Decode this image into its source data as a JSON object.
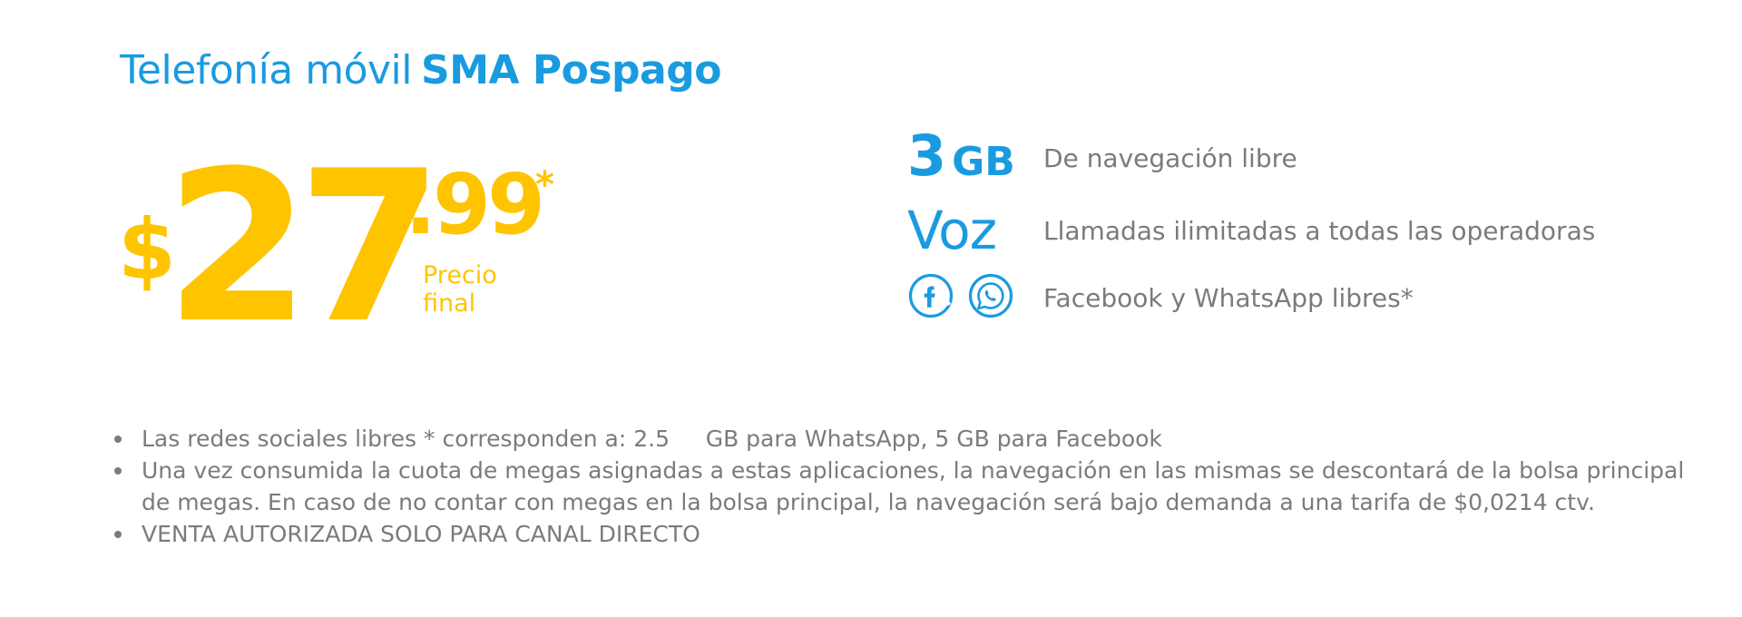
{
  "header": {
    "title_light": "Telefonía móvil",
    "title_bold": "SMA Pospago"
  },
  "price": {
    "currency": "$",
    "integer": "27",
    "decimal": ".99",
    "asterisk": "*",
    "note_line1": "Precio",
    "note_line2": "final"
  },
  "features": {
    "data": {
      "amount": "3",
      "unit": "GB",
      "description": "De navegación libre"
    },
    "voice": {
      "label": "Voz",
      "description": "Llamadas ilimitadas a todas las operadoras"
    },
    "social": {
      "icons": [
        "facebook-icon",
        "whatsapp-icon"
      ],
      "description": "Facebook y WhatsApp libres*"
    }
  },
  "notes": [
    "Las redes sociales libres * corresponden a: 2.5     GB para WhatsApp, 5 GB para Facebook",
    "Una vez consumida la cuota de megas asignadas a estas aplicaciones, la navegación en las mismas se descontará de la bolsa principal de megas. En caso de no contar con megas en la bolsa principal, la navegación será bajo demanda a una tarifa de $0,0214 ctv.",
    "VENTA AUTORIZADA SOLO PARA CANAL DIRECTO"
  ],
  "colors": {
    "brand_blue": "#1a9be0",
    "price_yellow": "#ffc400",
    "text_gray": "#7b7b7b"
  }
}
